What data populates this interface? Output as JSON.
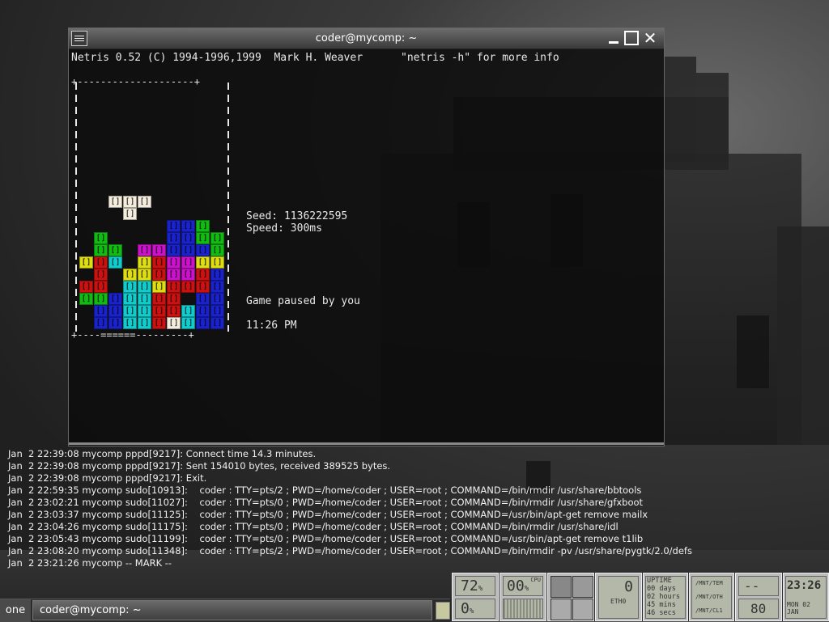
{
  "window": {
    "title": "coder@mycomp: ~",
    "header": "Netris 0.52 (C) 1994-1996,1999  Mark H. Weaver      \"netris -h\" for more info"
  },
  "game": {
    "seed": "Seed: 1136222595",
    "speed": "Speed: 300ms",
    "status": "Game paused by you",
    "clock": "11:26 PM",
    "top_border": "+--------------------+",
    "bottom_border": "+----======---------+",
    "cell_glyph": "[]"
  },
  "log": [
    "Jan  2 22:39:08 mycomp pppd[9217]: Connect time 14.3 minutes.",
    "Jan  2 22:39:08 mycomp pppd[9217]: Sent 154010 bytes, received 389525 bytes.",
    "Jan  2 22:39:08 mycomp pppd[9217]: Exit.",
    "Jan  2 22:59:35 mycomp sudo[10913]:    coder : TTY=pts/2 ; PWD=/home/coder ; USER=root ; COMMAND=/bin/rmdir /usr/share/bbtools",
    "Jan  2 23:02:21 mycomp sudo[11027]:    coder : TTY=pts/0 ; PWD=/home/coder ; USER=root ; COMMAND=/bin/rmdir /usr/share/gfxboot",
    "Jan  2 23:03:37 mycomp sudo[11125]:    coder : TTY=pts/0 ; PWD=/home/coder ; USER=root ; COMMAND=/usr/bin/apt-get remove mailx",
    "Jan  2 23:04:26 mycomp sudo[11175]:    coder : TTY=pts/0 ; PWD=/home/coder ; USER=root ; COMMAND=/bin/rmdir /usr/share/idl",
    "Jan  2 23:05:43 mycomp sudo[11199]:    coder : TTY=pts/0 ; PWD=/home/coder ; USER=root ; COMMAND=/usr/bin/apt-get remove t1lib",
    "Jan  2 23:08:20 mycomp sudo[11348]:    coder : TTY=pts/2 ; PWD=/home/coder ; USER=root ; COMMAND=/bin/rmdir -pv /usr/share/pygtk/2.0/defs",
    "Jan  2 23:21:26 mycomp -- MARK --"
  ],
  "taskbar": {
    "workspace": "one",
    "task": "coder@mycomp: ~"
  },
  "dockapps": {
    "mem": {
      "top": "72",
      "top_unit": "%",
      "bottom": "0",
      "bottom_unit": "%"
    },
    "cpu": {
      "label": "CPU",
      "value": "00",
      "unit": "%"
    },
    "net": {
      "value": "0",
      "label": "ETH0"
    },
    "uptime": {
      "label": "UPTIME",
      "lines": [
        "00  days",
        "02  hours",
        "45  mins",
        "46  secs"
      ]
    },
    "mounts": [
      "/MNT/TEM",
      "/MNT/OTH",
      "/MNT/CL1"
    ],
    "battery": {
      "top": "--",
      "bottom": "80"
    },
    "clock": {
      "time": "23:26",
      "date": "MON 02 JAN"
    }
  },
  "colors": {
    "red": "#cc1111",
    "green": "#11bb11",
    "blue": "#1a22cc",
    "magenta": "#cc11cc",
    "yellow": "#dddd11",
    "cyan": "#11cccc",
    "white": "#f4ecdc"
  },
  "board": [
    "....................",
    "....................",
    "....................",
    "....................",
    "....................",
    "....................",
    "....................",
    "....................",
    "....................",
    "....................",
    "...... .............",
    "....................",
    "..................",
    "..................",
    "....................",
    "...................."
  ],
  "pieces": [
    {
      "color": "white",
      "cells": [
        [
          2,
          0
        ],
        [
          3,
          0
        ],
        [
          4,
          0
        ],
        [
          3,
          1
        ]
      ],
      "origin": "top"
    },
    {
      "color": "blue",
      "cells": []
    }
  ]
}
